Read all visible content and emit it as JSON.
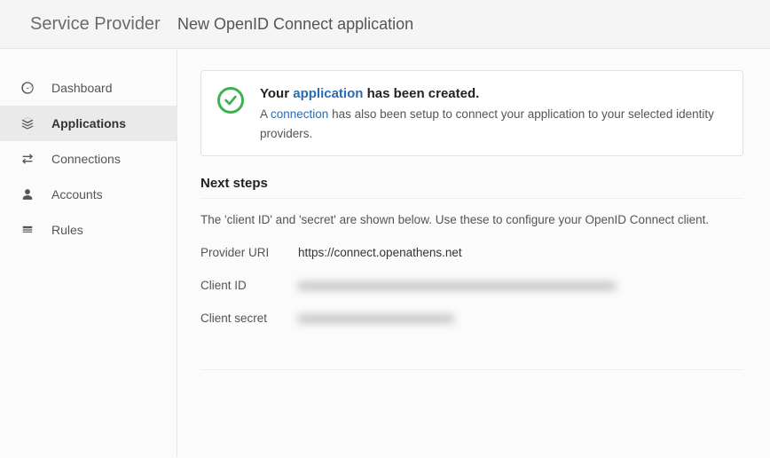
{
  "header": {
    "brand": "Service Provider",
    "page_title": "New OpenID Connect application"
  },
  "sidebar": {
    "items": [
      {
        "label": "Dashboard",
        "icon": "dashboard-icon",
        "active": false
      },
      {
        "label": "Applications",
        "icon": "applications-icon",
        "active": true
      },
      {
        "label": "Connections",
        "icon": "connections-icon",
        "active": false
      },
      {
        "label": "Accounts",
        "icon": "accounts-icon",
        "active": false
      },
      {
        "label": "Rules",
        "icon": "rules-icon",
        "active": false
      }
    ]
  },
  "alert": {
    "title_prefix": "Your ",
    "title_link": "application",
    "title_suffix": " has been created.",
    "sub_prefix": "A ",
    "sub_link": "connection",
    "sub_suffix": " has also been setup to connect your application to your selected identity providers."
  },
  "next_steps": {
    "heading": "Next steps",
    "desc": "The 'client ID' and 'secret' are shown below. Use these to configure your OpenID Connect client.",
    "rows": [
      {
        "label": "Provider URI",
        "value": "https://connect.openathens.net",
        "blurred": false
      },
      {
        "label": "Client ID",
        "value": "xxxxxxxxxxxxxxxxxxxxxxxxxxxxxxxxxxxxxxxxxxxxxxxxxxxxx",
        "blurred": true
      },
      {
        "label": "Client secret",
        "value": "xxxxxxxxxxxxxxxxxxxxxxxxxx",
        "blurred": true
      }
    ]
  }
}
